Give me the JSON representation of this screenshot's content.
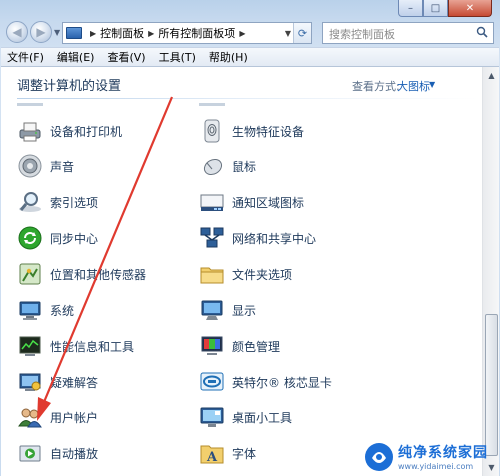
{
  "window": {
    "caption_buttons": {
      "minimize": "–",
      "maximize": "□",
      "close": "✕"
    }
  },
  "nav": {
    "back_icon": "back-arrow-icon",
    "forward_icon": "forward-arrow-icon",
    "breadcrumb": [
      "控制面板",
      "所有控制面板项"
    ],
    "search_placeholder": "搜索控制面板"
  },
  "menu": [
    "文件(F)",
    "编辑(E)",
    "查看(V)",
    "工具(T)",
    "帮助(H)"
  ],
  "header": {
    "title": "调整计算机的设置",
    "view_label": "查看方式:",
    "view_value": "大图标"
  },
  "items_left": [
    {
      "label": "设备和打印机",
      "icon": "printer-icon"
    },
    {
      "label": "声音",
      "icon": "speaker-icon"
    },
    {
      "label": "索引选项",
      "icon": "index-search-icon"
    },
    {
      "label": "同步中心",
      "icon": "sync-icon"
    },
    {
      "label": "位置和其他传感器",
      "icon": "location-sensor-icon"
    },
    {
      "label": "系统",
      "icon": "system-icon"
    },
    {
      "label": "性能信息和工具",
      "icon": "performance-icon"
    },
    {
      "label": "疑难解答",
      "icon": "troubleshoot-icon"
    },
    {
      "label": "用户帐户",
      "icon": "user-accounts-icon"
    },
    {
      "label": "自动播放",
      "icon": "autoplay-icon"
    }
  ],
  "items_right": [
    {
      "label": "生物特征设备",
      "icon": "fingerprint-icon"
    },
    {
      "label": "鼠标",
      "icon": "mouse-icon"
    },
    {
      "label": "通知区域图标",
      "icon": "notification-area-icon"
    },
    {
      "label": "网络和共享中心",
      "icon": "network-icon"
    },
    {
      "label": "文件夹选项",
      "icon": "folder-options-icon"
    },
    {
      "label": "显示",
      "icon": "display-icon"
    },
    {
      "label": "颜色管理",
      "icon": "color-management-icon"
    },
    {
      "label": "英特尔® 核芯显卡",
      "icon": "intel-graphics-icon"
    },
    {
      "label": "桌面小工具",
      "icon": "gadgets-icon"
    },
    {
      "label": "字体",
      "icon": "fonts-icon"
    }
  ],
  "watermark": {
    "title": "纯净系统家园",
    "url": "www.yidaimei.com"
  },
  "colors": {
    "link_blue": "#1a5fb4",
    "label_text": "#1e395b",
    "arrow_red": "#e03a2f"
  }
}
